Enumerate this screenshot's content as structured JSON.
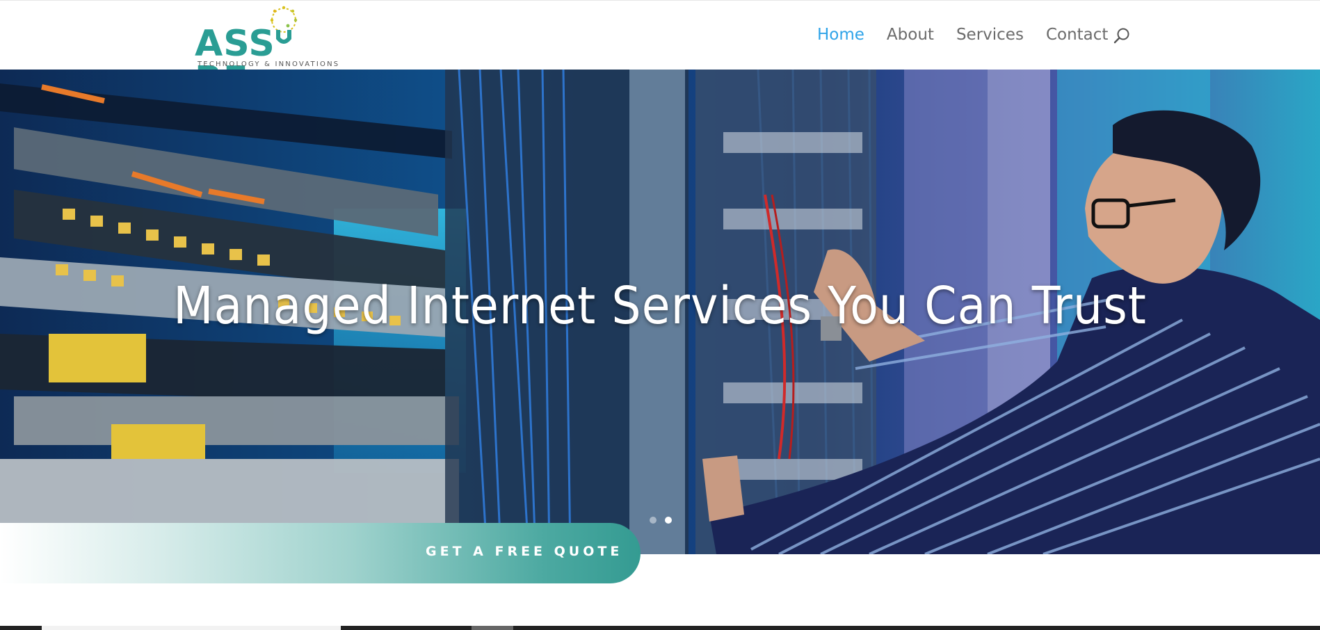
{
  "brand": {
    "name_left": "ASS",
    "name_right": "RE",
    "tagline": "TECHNOLOGY & INNOVATIONS",
    "colors": {
      "teal": "#2a9d94",
      "yellow": "#d9c21e",
      "green": "#8bc34a"
    }
  },
  "nav": {
    "items": [
      {
        "label": "Home",
        "active": true
      },
      {
        "label": "About",
        "active": false
      },
      {
        "label": "Services",
        "active": false
      },
      {
        "label": "Contact",
        "active": false
      }
    ],
    "active_color": "#2ea3e8",
    "search_icon": "search-icon"
  },
  "hero": {
    "title": "Managed Internet Services You Can Trust",
    "slides_count": 2,
    "active_slide": 2
  },
  "cta": {
    "label": "GET A FREE QUOTE"
  }
}
